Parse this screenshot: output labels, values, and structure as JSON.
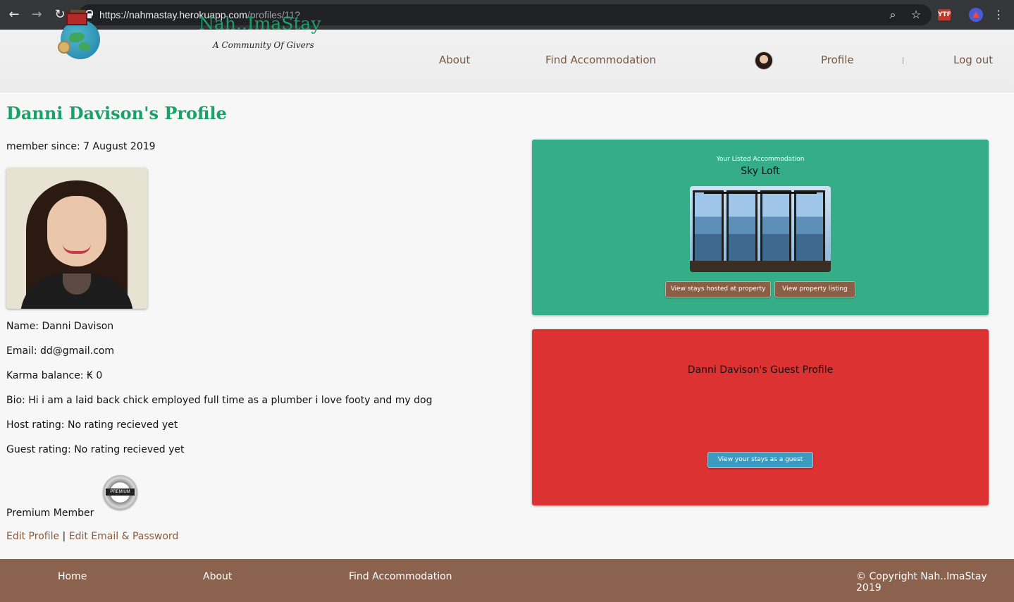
{
  "browser": {
    "url_host": "https://nahmastay.herokuapp.com",
    "url_path": "/profiles/11?",
    "ext_badge": "YTF"
  },
  "header": {
    "brand_title": "Nah..ImaStay",
    "brand_subtitle": "A Community Of Givers",
    "nav": {
      "about": "About",
      "find": "Find Accommodation",
      "profile": "Profile",
      "logout": "Log out"
    }
  },
  "profile": {
    "title": "Danni Davison's Profile",
    "member_since": "member since: 7 August 2019",
    "name": "Name: Danni Davison",
    "email": "Email: dd@gmail.com",
    "karma": "Karma balance: ₭ 0",
    "bio": "Bio: Hi i am a laid back chick employed full time as a plumber i love footy and my dog",
    "host_rating": "Host rating: No rating recieved yet",
    "guest_rating": "Guest rating: No rating recieved yet",
    "premium": "Premium Member",
    "premium_badge": "PREMIUM",
    "edit_profile": "Edit Profile",
    "separator": "|",
    "edit_email": "Edit Email & Password"
  },
  "listing_card": {
    "caption": "Your Listed Accommodation",
    "name": "Sky Loft",
    "btn_stays": "View stays hosted at property",
    "btn_listing": "View property listing",
    "color": "#35ad86"
  },
  "guest_card": {
    "title": "Danni Davison's Guest Profile",
    "btn": "View your stays as a guest",
    "color": "#dc3232"
  },
  "footer": {
    "home": "Home",
    "about": "About",
    "find": "Find Accommodation",
    "copyright": "© Copyright Nah..ImaStay 2019",
    "color": "#8b624d"
  }
}
